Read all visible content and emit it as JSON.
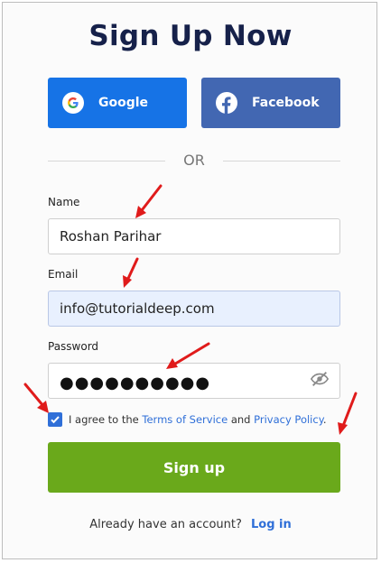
{
  "form": {
    "title": "Sign Up Now",
    "google_label": "Google",
    "facebook_label": "Facebook",
    "divider_text": "OR",
    "name_label": "Name",
    "name_value": "Roshan Parihar",
    "email_label": "Email",
    "email_value": "info@tutorialdeep.com",
    "password_label": "Password",
    "password_mask": "●●●●●●●●●●",
    "agree_prefix": "I agree to the",
    "terms_link": "Terms of Service",
    "agree_and": "and",
    "privacy_link": "Privacy Policy",
    "agree_suffix": ".",
    "signup_label": "Sign up",
    "already_text": "Already have an account?",
    "login_link": "Log in"
  },
  "icons": {
    "google": "google-icon",
    "facebook": "facebook-icon",
    "password_toggle": "eye-slash-icon",
    "checkbox": "checkmark-icon",
    "annotation": "red-arrow-icon"
  },
  "colors": {
    "title": "#16214a",
    "google": "#1673e6",
    "facebook": "#4267b2",
    "signup": "#6aa91b",
    "link": "#2f6fd8",
    "annotation": "#e01b1b"
  },
  "state": {
    "terms_checked": true
  }
}
